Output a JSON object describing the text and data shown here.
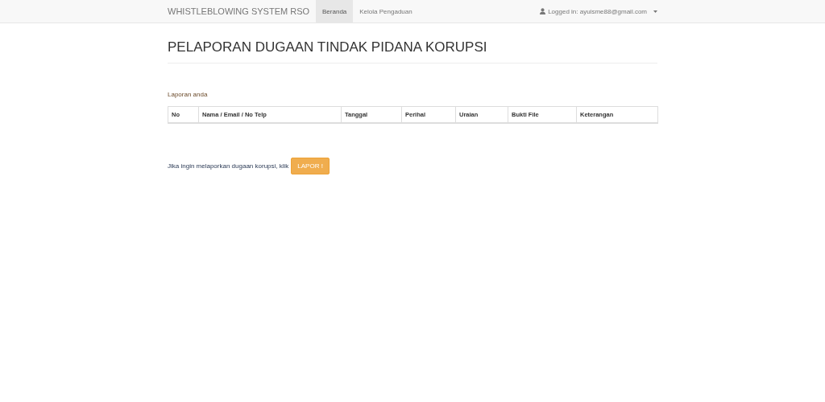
{
  "navbar": {
    "brand": "WHISTLEBLOWING SYSTEM RSO",
    "items": [
      {
        "label": "Beranda",
        "selected": true
      },
      {
        "label": "Kelola Pengaduan",
        "selected": false
      }
    ],
    "user": "Logged in: ayuisme88@gmail.com"
  },
  "page": {
    "title": "PELAPORAN DUGAAN TINDAK PIDANA KORUPSI",
    "section_label": "Laporan anda"
  },
  "table": {
    "columns": [
      "No",
      "Nama / Email / No Telp",
      "Tanggal",
      "Perihal",
      "Uraian",
      "Bukti File",
      "Keterangan"
    ]
  },
  "footer": {
    "prompt": "Jika ingin melaporkan dugaan korupsi, klik",
    "button": "LAPOR !"
  }
}
